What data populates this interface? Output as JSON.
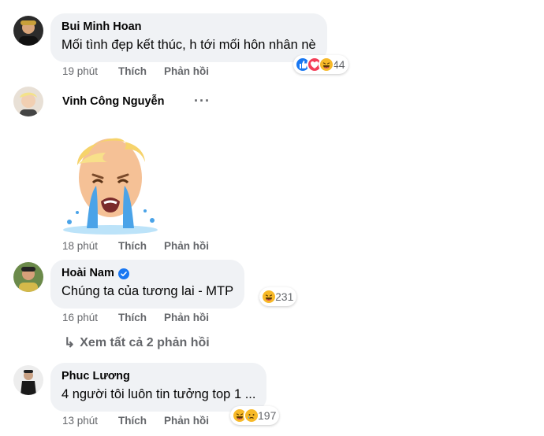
{
  "comments": [
    {
      "author": "Bui Minh Hoan",
      "text": "Mối tình đẹp kết thúc, h tới mối hôn nhân nè",
      "time": "19 phút",
      "like": "Thích",
      "reply": "Phản hồi",
      "reactions": {
        "icons": [
          "like-icon",
          "love-icon",
          "haha-icon"
        ],
        "count": "44"
      }
    },
    {
      "author": "Vinh Công Nguyễn",
      "more_label": "···",
      "sticker": "crying-face-sticker",
      "time": "18 phút",
      "like": "Thích",
      "reply": "Phản hồi"
    },
    {
      "author": "Hoài Nam",
      "verified": true,
      "text": "Chúng ta của tương lai - MTP",
      "time": "16 phút",
      "like": "Thích",
      "reply": "Phản hồi",
      "reactions": {
        "icons": [
          "haha-icon"
        ],
        "count": "231"
      }
    },
    {
      "author": "Phuc Lương",
      "text": "4 người tôi luôn tin tưởng top 1 ...",
      "time": "13 phút",
      "like": "Thích",
      "reply": "Phản hồi",
      "reactions": {
        "icons": [
          "haha-icon",
          "sad-icon"
        ],
        "count": "197"
      }
    }
  ],
  "view_replies": {
    "arrow": "↳",
    "label": "Xem tất cả 2 phản hồi"
  },
  "colors": {
    "bubble": "#f0f2f5",
    "secondary_text": "#65676b",
    "like_blue": "#1877f2",
    "love_red": "#f33e58",
    "haha_yellow": "#f7b928",
    "verified_blue": "#1877f2"
  }
}
